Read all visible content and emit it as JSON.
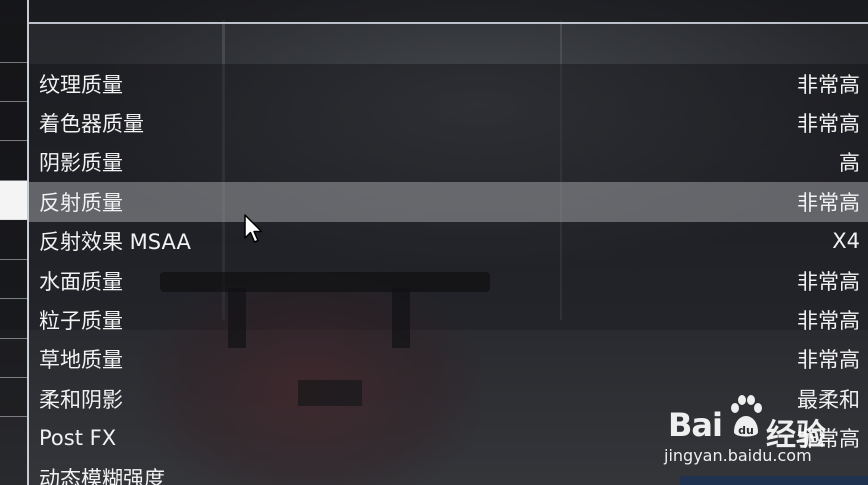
{
  "settings": {
    "items": [
      {
        "label": "纹理质量",
        "value": "非常高"
      },
      {
        "label": "着色器质量",
        "value": "非常高"
      },
      {
        "label": "阴影质量",
        "value": "高"
      },
      {
        "label": "反射质量",
        "value": "非常高"
      },
      {
        "label": "反射效果 MSAA",
        "value": "X4"
      },
      {
        "label": "水面质量",
        "value": "非常高"
      },
      {
        "label": "粒子质量",
        "value": "非常高"
      },
      {
        "label": "草地质量",
        "value": "非常高"
      },
      {
        "label": "柔和阴影",
        "value": "最柔和"
      },
      {
        "label": "Post FX",
        "value": "非常高"
      },
      {
        "label": "动态模糊强度",
        "value": ""
      }
    ],
    "selected_index": 3
  },
  "watermark": {
    "logo_text": "Bai",
    "logo_cn": "经验",
    "url": "jingyan.baidu.com"
  },
  "colors": {
    "text": "#f2f2f2",
    "selected_row": "#7a7c80",
    "accent_line": "#c7cbd3"
  }
}
